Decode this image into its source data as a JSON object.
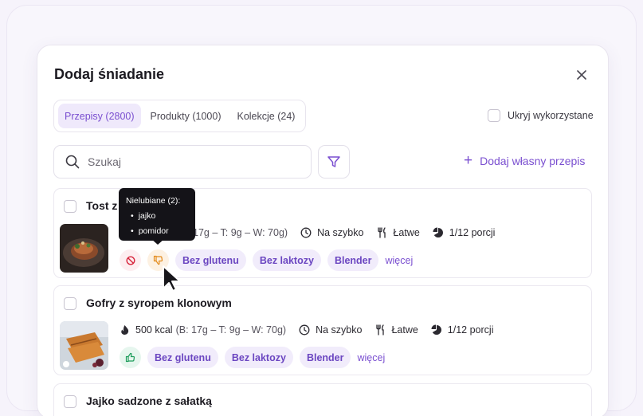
{
  "modal": {
    "title": "Dodaj śniadanie"
  },
  "tabs": [
    {
      "label": "Przepisy (2800)",
      "active": true
    },
    {
      "label": "Produkty (1000)",
      "active": false
    },
    {
      "label": "Kolekcje (24)",
      "active": false
    }
  ],
  "hide_used": {
    "label": "Ukryj wykorzystane",
    "checked": false
  },
  "search": {
    "placeholder": "Szukaj",
    "value": ""
  },
  "add_own": {
    "label": "Dodaj własny przepis"
  },
  "recipes": [
    {
      "title": "Tost z",
      "kcal": "",
      "macros": "17g – T: 9g – W: 70g)",
      "time": "Na szybko",
      "difficulty": "Łatwe",
      "portions": "1/12 porcji",
      "tags": [
        "Bez glutenu",
        "Bez laktozy",
        "Blender"
      ],
      "more": "więcej",
      "status_icons": [
        "ban-icon",
        "thumbs-down-icon"
      ]
    },
    {
      "title": "Gofry z syropem klonowym",
      "kcal": "500 kcal",
      "macros": "(B: 17g – T: 9g – W: 70g)",
      "time": "Na szybko",
      "difficulty": "Łatwe",
      "portions": "1/12 porcji",
      "tags": [
        "Bez glutenu",
        "Bez laktozy",
        "Blender"
      ],
      "more": "więcej",
      "status_icons": [
        "thumbs-up-icon"
      ]
    },
    {
      "title": "Jajko sadzone z sałatką"
    }
  ],
  "tooltip": {
    "title": "Nielubiane (2):",
    "items": [
      "jajko",
      "pomidor"
    ]
  },
  "colors": {
    "accent": "#7a4fd0",
    "tag_bg": "#f1ecfb",
    "dislike_bg": "#fdeef0",
    "warning_bg": "#fdf1e2",
    "like_bg": "#e6f6ee"
  }
}
